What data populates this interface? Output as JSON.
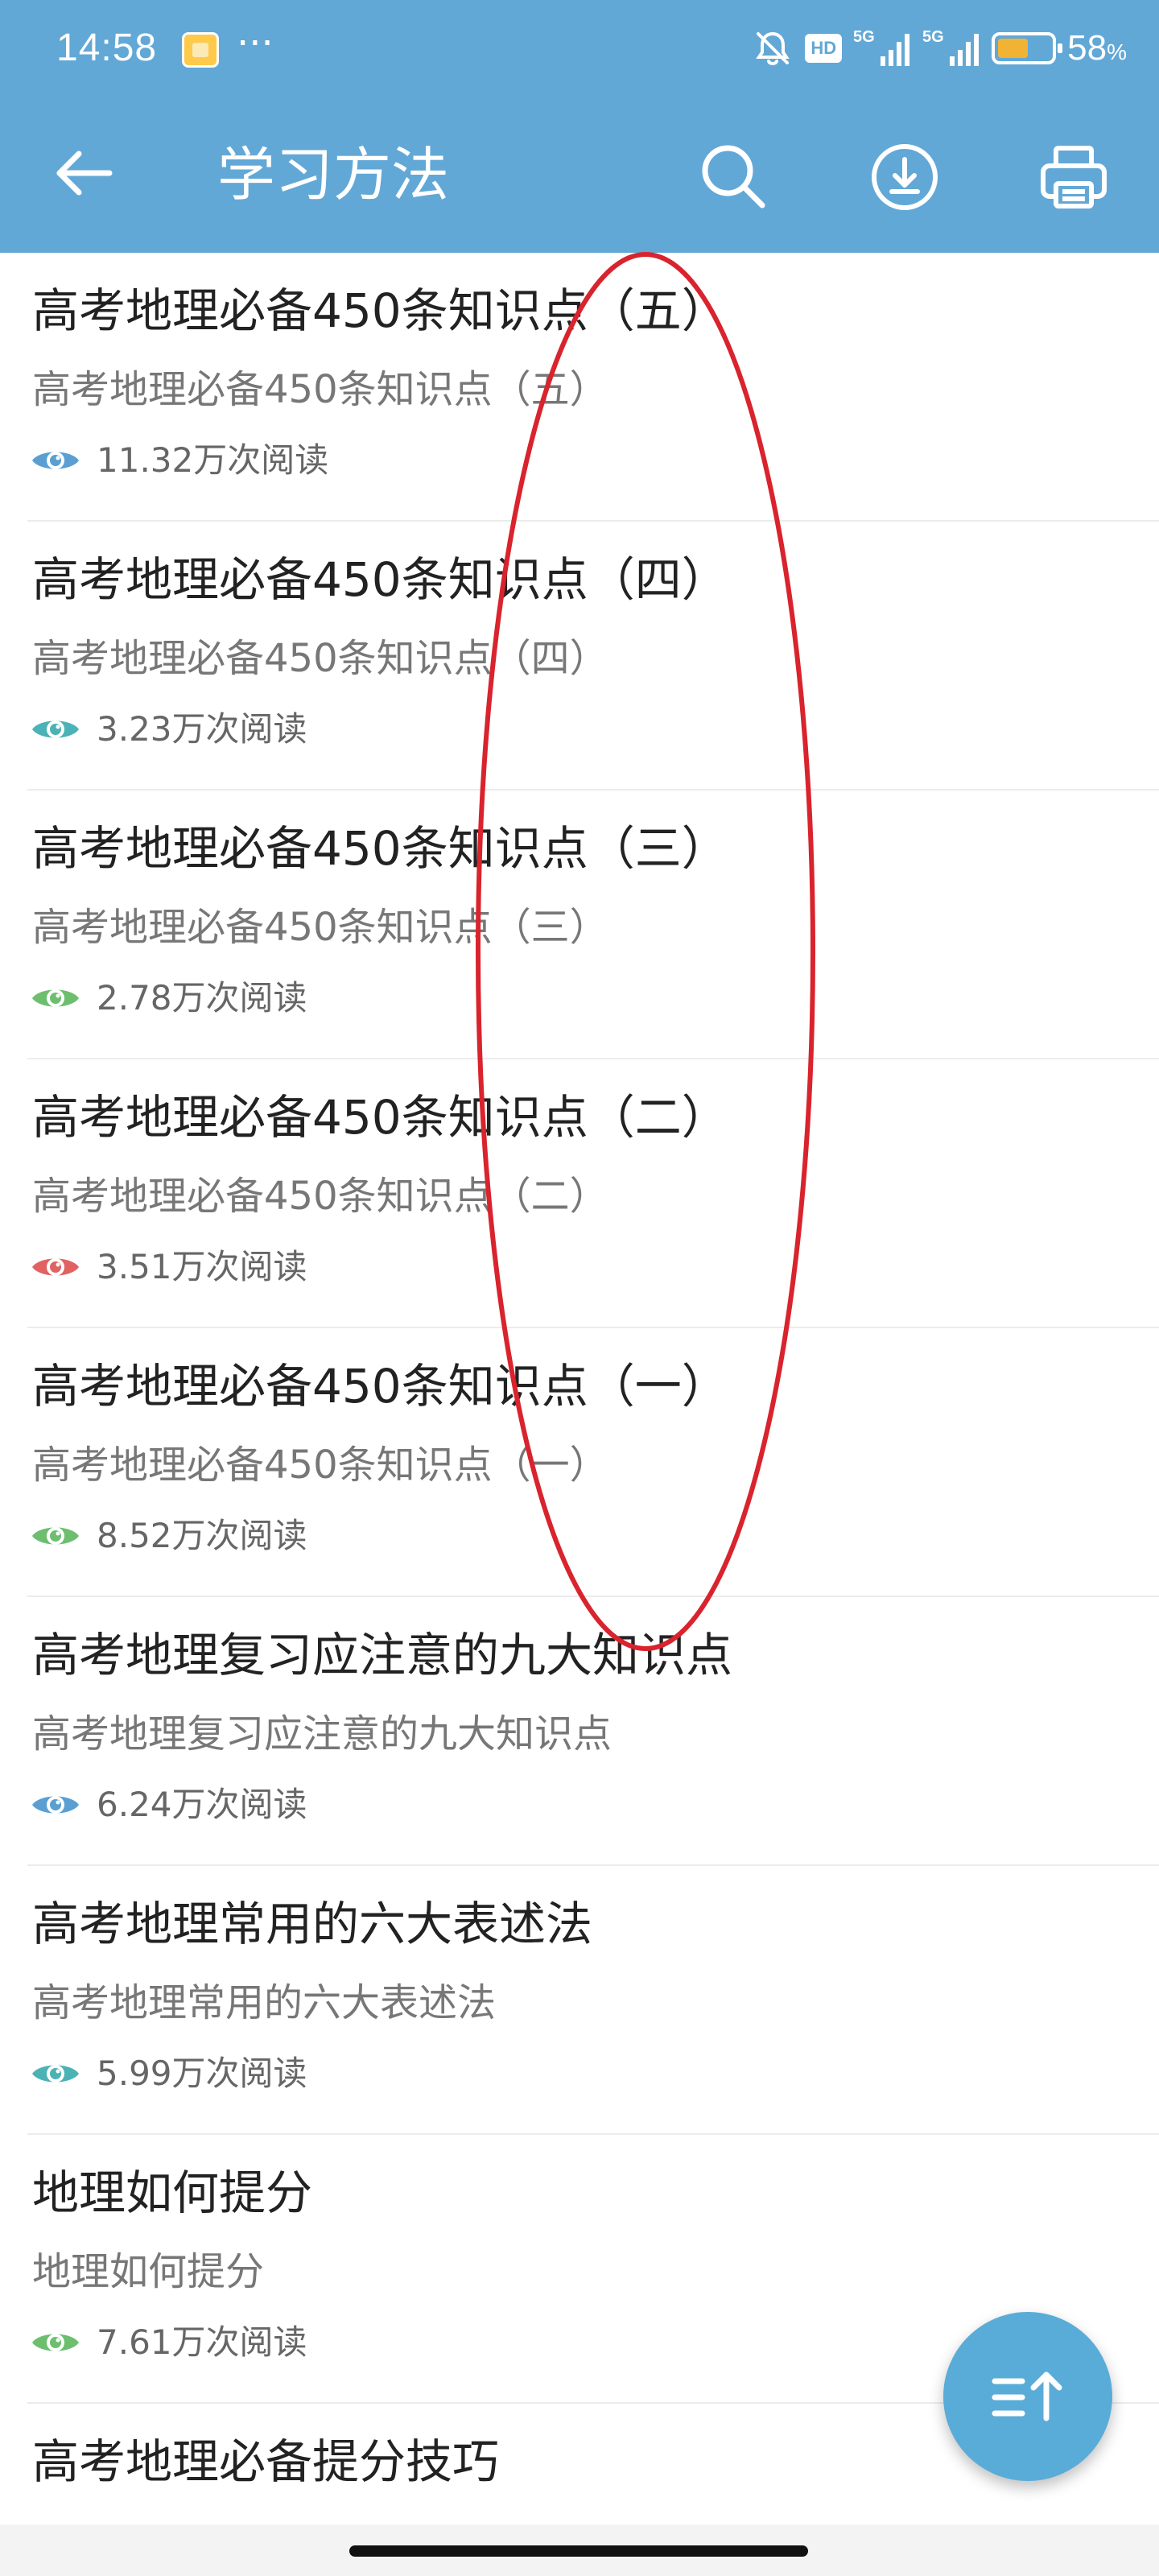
{
  "status_bar": {
    "time": "14:58",
    "more": "···",
    "hd_label": "HD",
    "network_1": "5G",
    "network_2": "5G",
    "battery_percent": "58",
    "battery_unit": "%",
    "battery_level": 0.58,
    "icons": [
      "app-notification-icon",
      "mute-icon",
      "signal-icon",
      "battery-icon"
    ]
  },
  "toolbar": {
    "title": "学习方法",
    "back_icon": "arrow-left-icon",
    "search_icon": "search-icon",
    "download_icon": "download-icon",
    "print_icon": "print-icon"
  },
  "articles": [
    {
      "title": "高考地理必备450条知识点（五）",
      "subtitle": "高考地理必备450条知识点（五）",
      "views": "11.32万次阅读",
      "eye_color": "#5b9fd2"
    },
    {
      "title": "高考地理必备450条知识点（四）",
      "subtitle": "高考地理必备450条知识点（四）",
      "views": "3.23万次阅读",
      "eye_color": "#4bb3b5"
    },
    {
      "title": "高考地理必备450条知识点（三）",
      "subtitle": "高考地理必备450条知识点（三）",
      "views": "2.78万次阅读",
      "eye_color": "#6dbf6f"
    },
    {
      "title": "高考地理必备450条知识点（二）",
      "subtitle": "高考地理必备450条知识点（二）",
      "views": "3.51万次阅读",
      "eye_color": "#e06262"
    },
    {
      "title": "高考地理必备450条知识点（一）",
      "subtitle": "高考地理必备450条知识点（一）",
      "views": "8.52万次阅读",
      "eye_color": "#6dbf6f"
    },
    {
      "title": "高考地理复习应注意的九大知识点",
      "subtitle": "高考地理复习应注意的九大知识点",
      "views": "6.24万次阅读",
      "eye_color": "#5b9fd2"
    },
    {
      "title": "高考地理常用的六大表述法",
      "subtitle": "高考地理常用的六大表述法",
      "views": "5.99万次阅读",
      "eye_color": "#4bb3b5"
    },
    {
      "title": "地理如何提分",
      "subtitle": "地理如何提分",
      "views": "7.61万次阅读",
      "eye_color": "#6dbf6f"
    },
    {
      "title": "高考地理必备提分技巧",
      "subtitle": "",
      "views": "",
      "eye_color": ""
    }
  ],
  "annotation": {
    "shape": "red-ellipse-icon",
    "color": "#d9232d"
  },
  "fab": {
    "icon": "sort-ascending-icon",
    "color": "#5aacd8"
  },
  "colors": {
    "header": "#62a8d6",
    "title_text": "#222222",
    "subtitle_text": "#777777"
  }
}
